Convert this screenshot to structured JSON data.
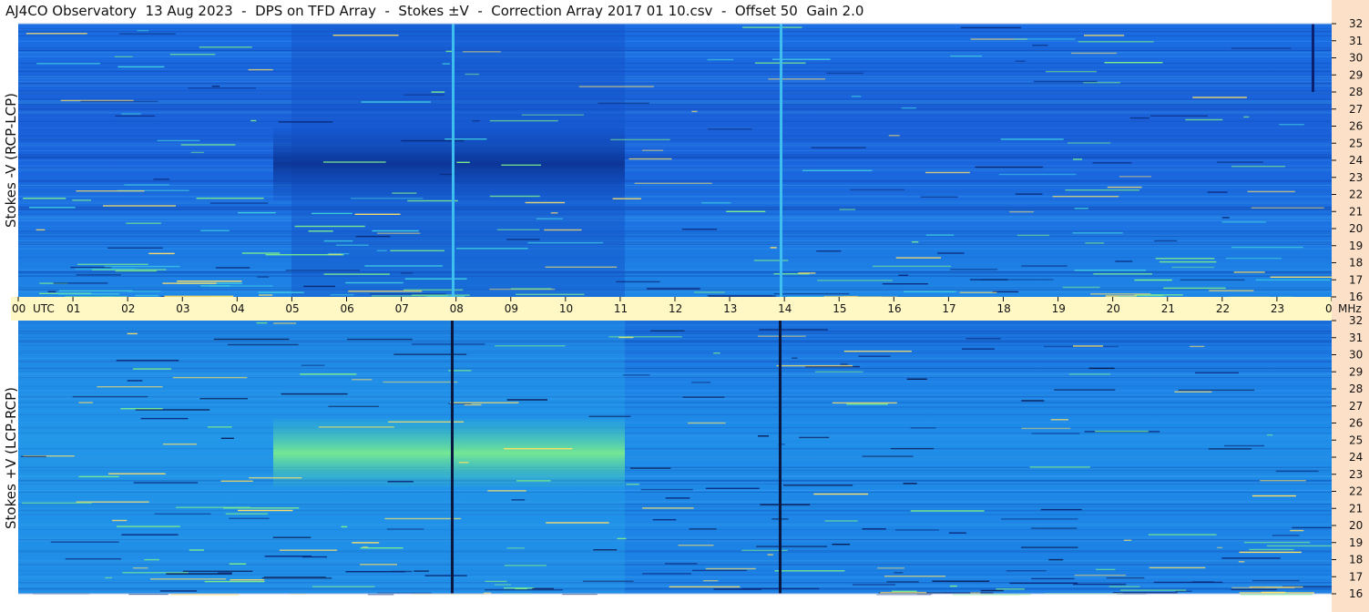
{
  "title": "AJ4CO Observatory  13 Aug 2023  -  DPS on TFD Array  -  Stokes ±V  -  Correction Array 2017 01 10.csv  -  Offset 50  Gain 2.0",
  "panels": [
    {
      "ylabel": "Stokes -V (RCP-LCP)"
    },
    {
      "ylabel": "Stokes +V (LCP-RCP)"
    }
  ],
  "colors": {
    "time_axis_band": "#fff8c4",
    "freq_axis_band": "#fde0c8",
    "base_top": "#1a6ae6",
    "base_bottom": "#1b85e8",
    "highlight": "#5fe08a",
    "dark": "#0a2a7a"
  },
  "chart_data": [
    {
      "type": "heatmap",
      "title": "",
      "xlabel": "UTC",
      "ylabel": "Stokes -V (RCP-LCP)",
      "x_ticks": [
        "00",
        "01",
        "02",
        "03",
        "04",
        "05",
        "06",
        "07",
        "08",
        "09",
        "10",
        "11",
        "12",
        "13",
        "14",
        "15",
        "16",
        "17",
        "18",
        "19",
        "20",
        "21",
        "22",
        "23",
        "00"
      ],
      "x_range_hours": [
        0,
        24
      ],
      "y_unit": "MHz",
      "y_range_mhz": [
        16,
        32
      ],
      "y_ticks": [
        "32",
        "31",
        "30",
        "29",
        "28",
        "27",
        "26",
        "25",
        "24",
        "23",
        "22",
        "21",
        "20",
        "19",
        "18",
        "17",
        "16"
      ]
    },
    {
      "type": "heatmap",
      "title": "",
      "xlabel": "UTC",
      "ylabel": "Stokes +V (LCP-RCP)",
      "x_ticks": [
        "00",
        "01",
        "02",
        "03",
        "04",
        "05",
        "06",
        "07",
        "08",
        "09",
        "10",
        "11",
        "12",
        "13",
        "14",
        "15",
        "16",
        "17",
        "18",
        "19",
        "20",
        "21",
        "22",
        "23",
        "00"
      ],
      "x_range_hours": [
        0,
        24
      ],
      "y_unit": "MHz",
      "y_range_mhz": [
        16,
        32
      ],
      "y_ticks": [
        "32",
        "31",
        "30",
        "29",
        "28",
        "27",
        "26",
        "25",
        "24",
        "23",
        "22",
        "21",
        "20",
        "19",
        "18",
        "17",
        "16"
      ]
    }
  ],
  "axis_labels": {
    "utc": "UTC",
    "mhz": "MHz"
  }
}
